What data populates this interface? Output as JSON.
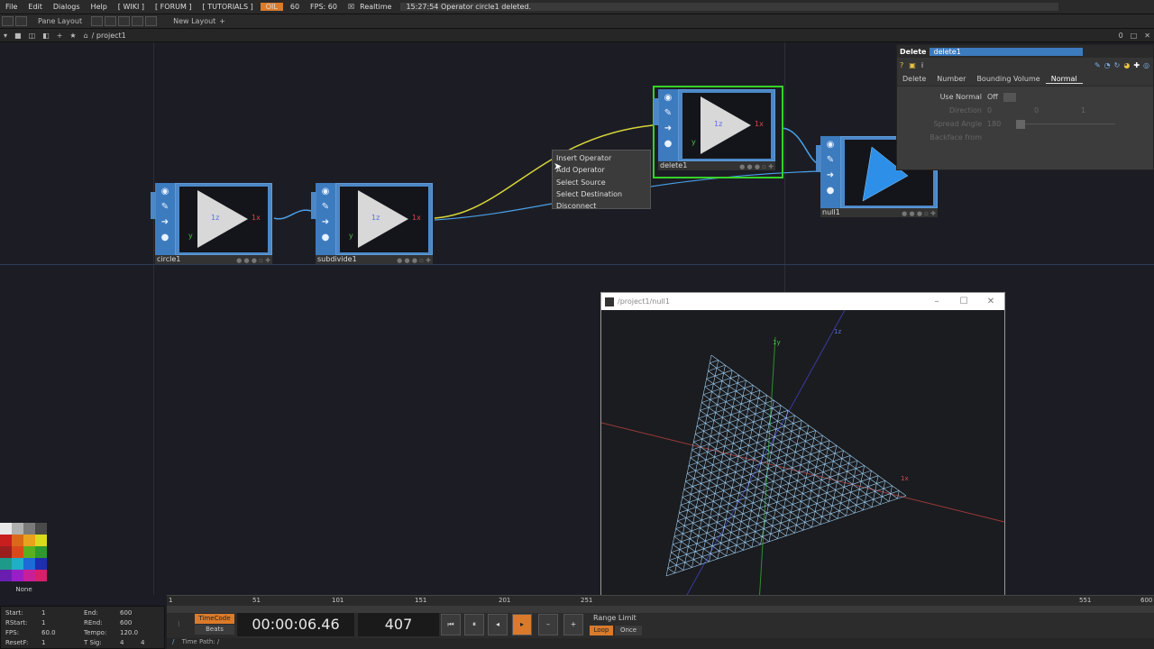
{
  "menubar": {
    "items": [
      "File",
      "Edit",
      "Dialogs",
      "Help"
    ],
    "tags": [
      "[ WIKI ]",
      "[ FORUM ]",
      "[ TUTORIALS ]"
    ],
    "oil": "OIL",
    "fps_dim": "60",
    "fps": "FPS:  60",
    "realtime": "Realtime",
    "status": "15:27:54 Operator circle1 deleted."
  },
  "panebar": {
    "pane_layout": "Pane Layout",
    "new_layout": "New Layout"
  },
  "pathbar": {
    "path": "/ project1"
  },
  "nodes": [
    {
      "name": "circle1"
    },
    {
      "name": "subdivide1"
    },
    {
      "name": "delete1"
    },
    {
      "name": "null1"
    }
  ],
  "node_axis": {
    "z": "1z",
    "x": "1x",
    "y": "y"
  },
  "context_menu": [
    "Insert Operator",
    "Add Operator",
    "Select Source",
    "Select Destination",
    "Disconnect"
  ],
  "params": {
    "title": "Delete",
    "name": "delete1",
    "tabs": [
      "Delete",
      "Number",
      "Bounding Volume",
      "Normal"
    ],
    "rows": [
      {
        "label": "Use Normal",
        "value": "Off",
        "dim": false
      },
      {
        "label": "Direction",
        "value": "0",
        "extra": [
          "0",
          "1"
        ],
        "dim": true
      },
      {
        "label": "Spread Angle",
        "value": "180",
        "dim": true
      },
      {
        "label": "Backface from",
        "value": "",
        "dim": true
      }
    ]
  },
  "viewer": {
    "title": "/project1/null1",
    "axis": {
      "y": "1y",
      "z": "1z",
      "x": "1x"
    }
  },
  "timeline": {
    "ticks": [
      "1",
      "51",
      "101",
      "151",
      "201",
      "251",
      "551",
      "600"
    ]
  },
  "stats": {
    "start": {
      "label": "Start:",
      "value": "1"
    },
    "rstart": {
      "label": "RStart:",
      "value": "1"
    },
    "fps": {
      "label": "FPS:",
      "value": "60.0"
    },
    "resetf": {
      "label": "ResetF:",
      "value": "1"
    },
    "end": {
      "label": "End:",
      "value": "600"
    },
    "rend": {
      "label": "REnd:",
      "value": "600"
    },
    "tempo": {
      "label": "Tempo:",
      "value": "120.0"
    },
    "tsig": {
      "label": "T Sig:",
      "value": "4",
      "value2": "4"
    }
  },
  "transport": {
    "timecode_label": "TimeCode",
    "beats_label": "Beats",
    "timecode": "00:00:06.46",
    "frame": "407",
    "range_limit": "Range Limit",
    "loop": "Loop",
    "once": "Once"
  },
  "timepath": "Time Path: /",
  "palette": {
    "none_label": "None"
  },
  "colors": {
    "accent": "#3d7bbf",
    "select": "#37d12a",
    "orange": "#d97b2b"
  }
}
